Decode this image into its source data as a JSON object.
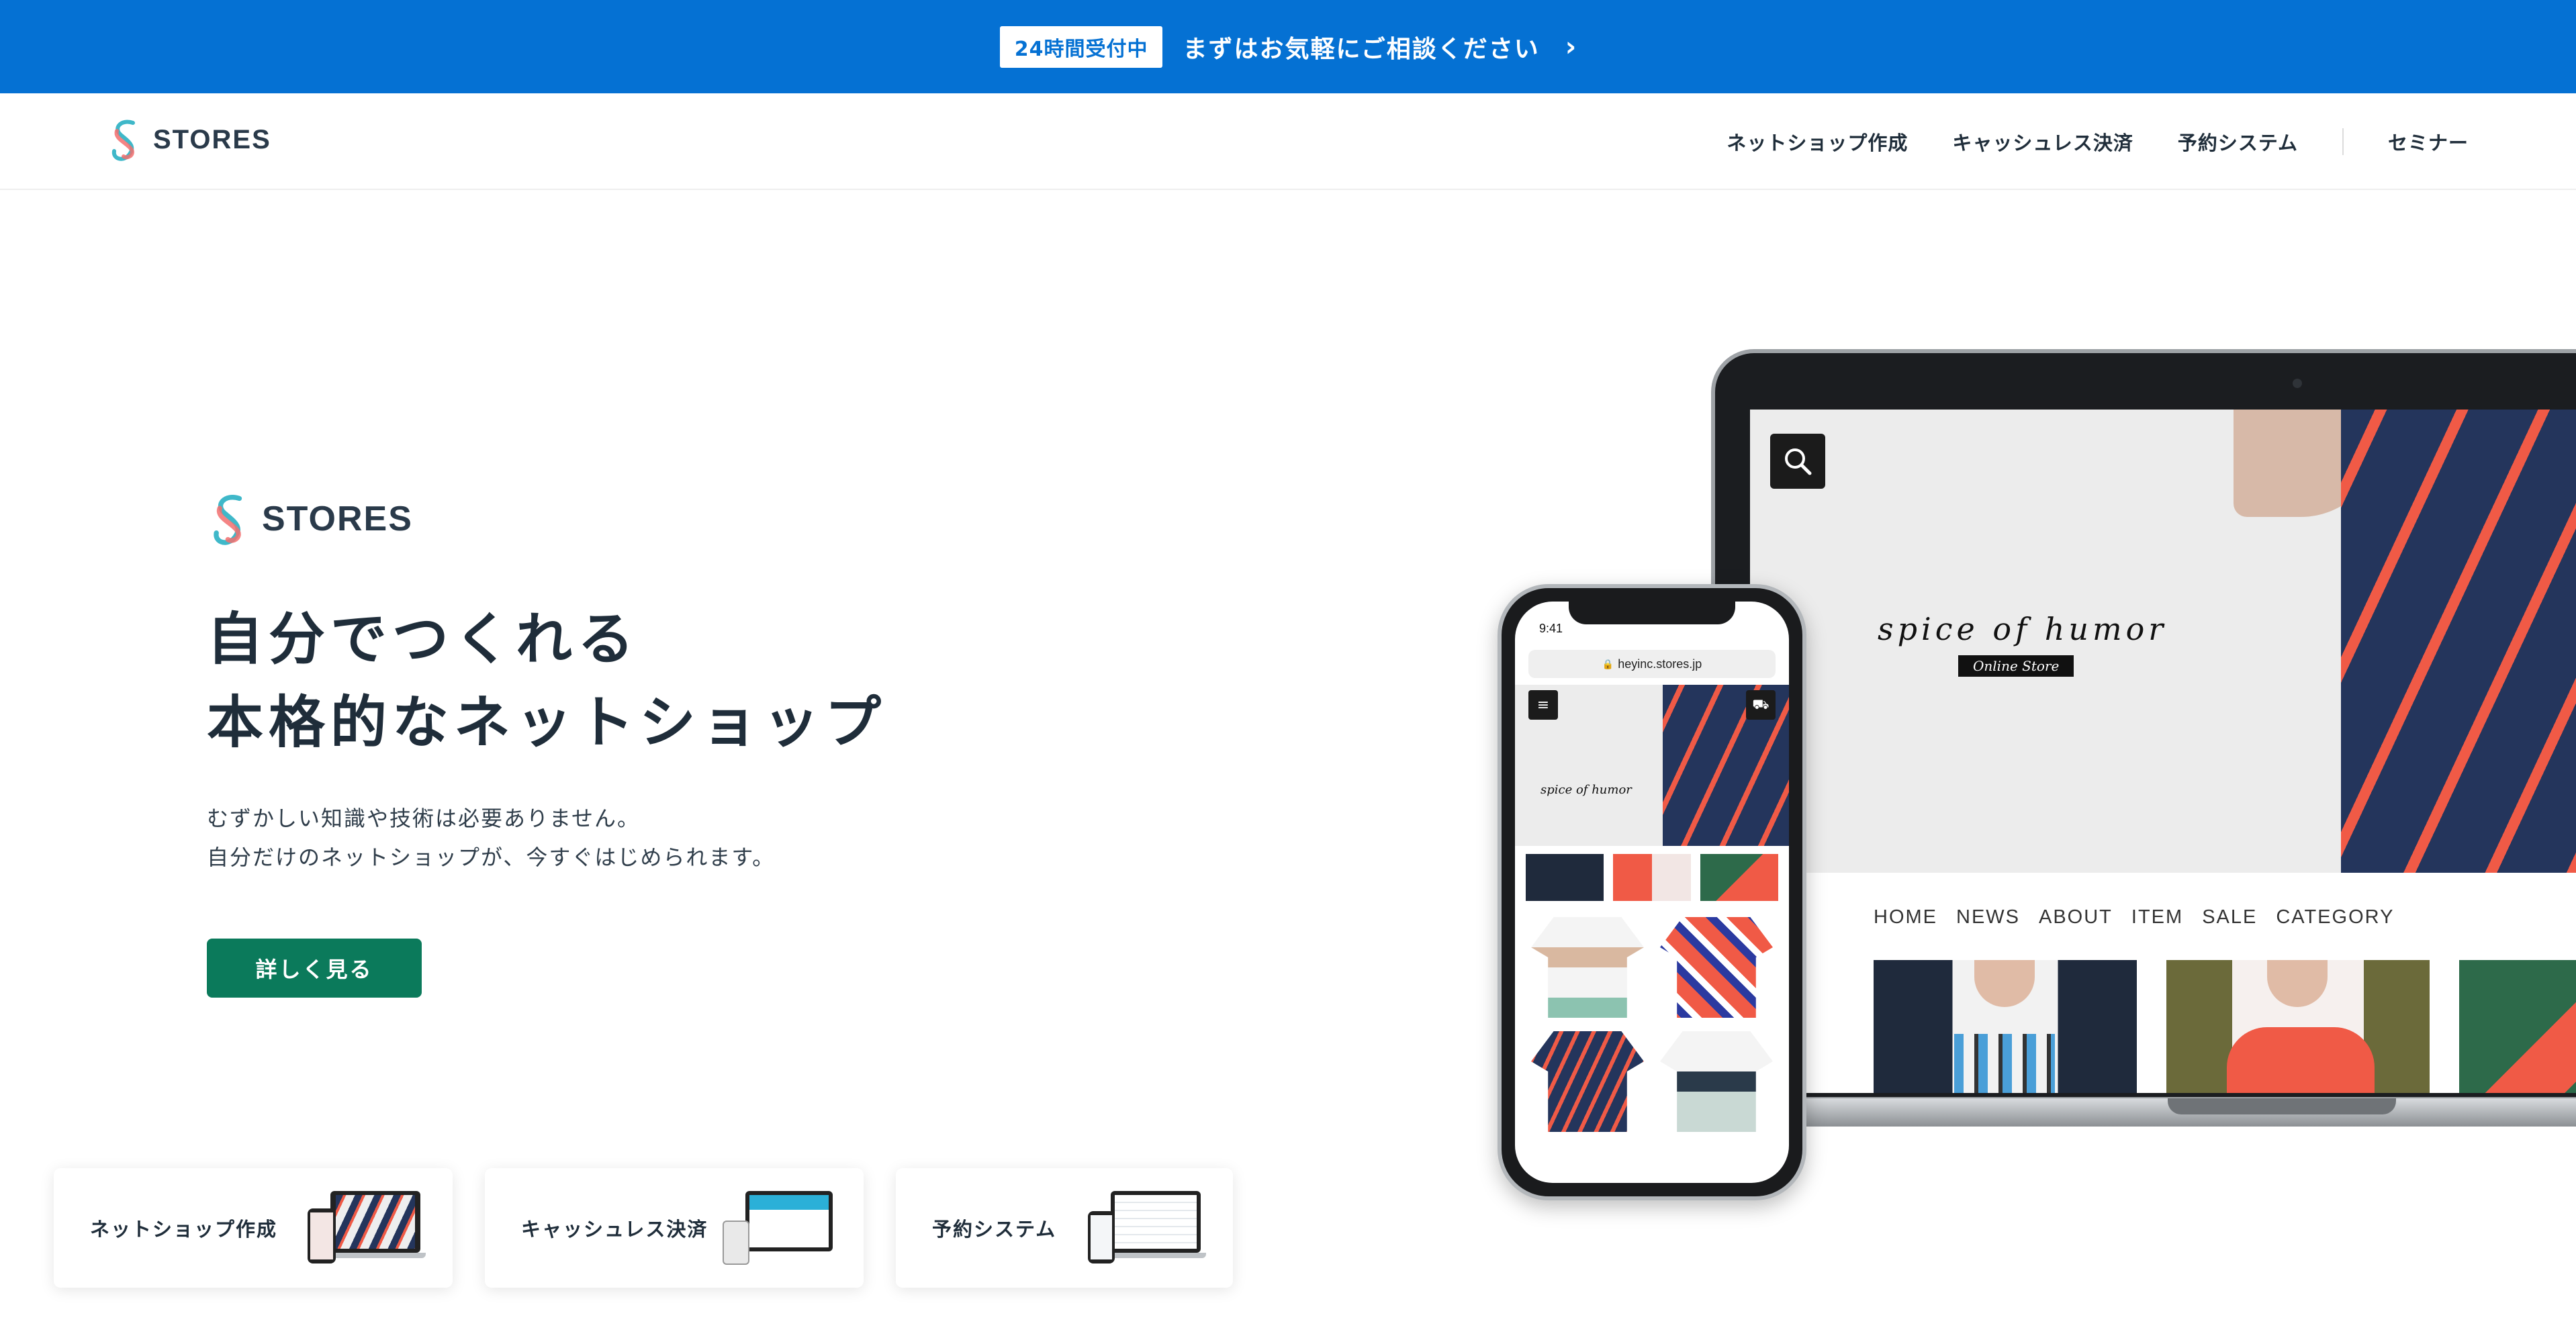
{
  "announcement": {
    "badge": "24時間受付中",
    "message": "まずはお気軽にご相談ください",
    "chevron": "›",
    "background": "#0571d3"
  },
  "header": {
    "logo_text": "STORES",
    "nav": [
      "ネットショップ作成",
      "キャッシュレス決済",
      "予約システム",
      "セミナー"
    ]
  },
  "hero": {
    "logo_text": "STORES",
    "headline_line1": "自分でつくれる",
    "headline_line2": "本格的なネットショップ",
    "desc_line1": "むずかしい知識や技術は必要ありません。",
    "desc_line2": "自分だけのネットショップが、今すぐはじめられます。",
    "cta_label": "詳しく見る",
    "cta_color": "#0b7a5b"
  },
  "cards": [
    {
      "label": "ネットショップ作成"
    },
    {
      "label": "キャッシュレス決済"
    },
    {
      "label": "予約システム"
    }
  ],
  "laptop_shop": {
    "brand": "spice of humor",
    "tag": "Online Store",
    "nav": [
      "HOME",
      "NEWS",
      "ABOUT",
      "ITEM",
      "SALE",
      "CATEGORY"
    ]
  },
  "phone_shop": {
    "time": "9:41",
    "url": "heyinc.stores.jp",
    "brand": "spice of humor"
  },
  "icons": [
    "stores-logo-icon",
    "chevron-right-icon",
    "search-icon",
    "menu-icon",
    "cart-icon",
    "lock-icon"
  ]
}
